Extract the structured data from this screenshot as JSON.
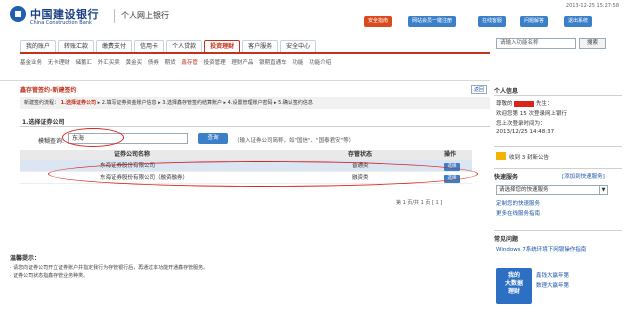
{
  "header": {
    "bank_name_cn": "中国建设银行",
    "bank_name_en": "China Construction Bank",
    "subtitle": "个人网上银行",
    "datetime": "2013-12-25 15:27:58",
    "buttons": [
      "安全指南",
      "网站会员一键注册",
      "在线客服",
      "问题解答",
      "退出系统"
    ]
  },
  "nav": {
    "tabs": [
      "我的账户",
      "转账汇款",
      "缴费支付",
      "信用卡",
      "个人贷款",
      "投资理财",
      "客户服务",
      "安全中心"
    ],
    "active": "投资理财"
  },
  "subnav": [
    "基金业务",
    "无卡理财",
    "储蓄汇",
    "外汇买卖",
    "黄金买",
    "债券",
    "期货",
    "鑫存管",
    "投资管理",
    "理财产品",
    "银期直通车",
    "功能",
    "功能介绍"
  ],
  "search": {
    "placeholder": "请输入功能名称",
    "button": "搜索"
  },
  "breadcrumb": "鑫存管签约-新建签约",
  "back_label": "返回",
  "steps": {
    "prefix": "新建签约流程：",
    "items": [
      "1.选择证券公司",
      "2.填写证券资金账户信息",
      "3.选择鑫存管签约结算账户",
      "4.设置管理账户密码",
      "5.确认签约信息"
    ]
  },
  "section": {
    "title": "1.选择证券公司",
    "fuzzy_label": "模糊查询:",
    "fuzzy_value": "东海",
    "query_button": "查询",
    "hint": "（输入证券公司简称，如\"国信\"、\"国泰君安\"等）"
  },
  "table": {
    "headers": {
      "name": "证券公司名称",
      "status": "存管状态",
      "op": "操作"
    },
    "rows": [
      {
        "name": "东海证券股份有限公司",
        "status": "普通类",
        "op": "选择"
      },
      {
        "name": "东海证券股份有限公司（融资融券）",
        "status": "融资类",
        "op": "选择"
      }
    ]
  },
  "pager": "第 1 页/共 1 页 [ 1 ]",
  "tips": {
    "title": "温馨提示：",
    "lines": [
      "· 请您向证券公司开立证券账户并指定我行为存管银行后，再通过本功能开通鑫存管服务。",
      "· 证券公司状态指鑫存管业务种类。"
    ]
  },
  "sidebar": {
    "info_title": "个人信息",
    "greeting_prefix": "尊敬的",
    "greeting_suffix": "先生：",
    "welcome": "欢迎您第 15 次登录网上银行",
    "last_login_label": "您上次登录时间为：",
    "last_login": "2013/12/25 14:48:37",
    "messages": "收到 3 封新公告",
    "quick_title": "快速服务",
    "quick_link": "[添加到快速服务]",
    "quick_select": "请选择您的快速服务",
    "quick_links": [
      "定制您的快速服务",
      "更多在线服务指南"
    ],
    "faq_title": "常见问题",
    "faq_link": "Windows 7系统环境下网银操作指南",
    "ad_text": [
      "我的",
      "大数据",
      "理财"
    ],
    "ad_lines": [
      "鑫钱大赢年第",
      "数理大赢年第"
    ]
  }
}
